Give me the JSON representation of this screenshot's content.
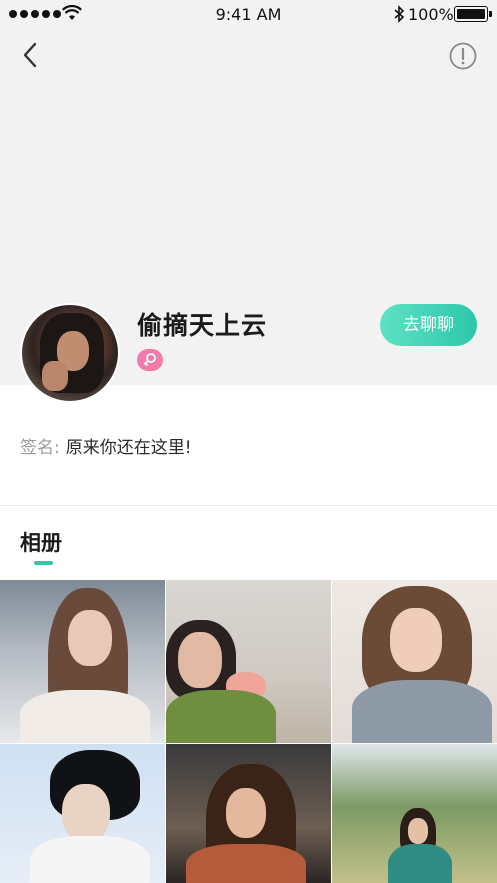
{
  "status_bar": {
    "time": "9:41 AM",
    "battery_percent": "100%",
    "signal_icon": "signal-dots-icon",
    "wifi_icon": "wifi-icon",
    "bluetooth_icon": "bluetooth-icon",
    "battery_icon": "battery-icon"
  },
  "nav": {
    "back_icon": "chevron-left-icon",
    "report_icon": "exclamation-circle-icon"
  },
  "profile": {
    "nickname": "偷摘天上云",
    "gender_icon": "female-icon",
    "gender_badge_color": "#f27aa8",
    "chat_button_label": "去聊聊",
    "accent_color": "#2cc8a8"
  },
  "signature": {
    "label": "签名:",
    "text": "原来你还在这里!"
  },
  "album": {
    "title": "相册",
    "photos": [
      {
        "subject": "photo-woman-eyes-closed"
      },
      {
        "subject": "photo-woman-with-flowers"
      },
      {
        "subject": "photo-woman-smiling"
      },
      {
        "subject": "photo-man-portrait"
      },
      {
        "subject": "photo-woman-in-car"
      },
      {
        "subject": "photo-woman-in-field"
      }
    ]
  }
}
